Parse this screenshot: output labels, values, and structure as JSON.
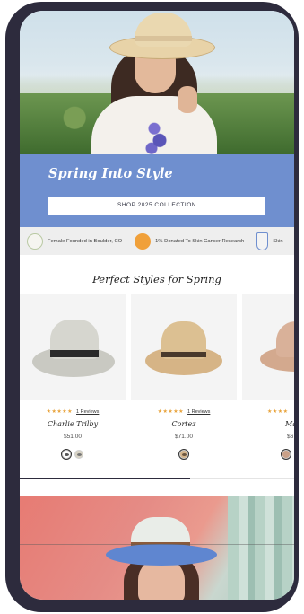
{
  "hero": {
    "title": "Spring Into Style",
    "cta_label": "SHOP 2025 COLLECTION"
  },
  "trust_strip": [
    {
      "icon": "boulder-badge-icon",
      "text": "Female Founded in Boulder, CO"
    },
    {
      "icon": "skin-cancer-badge-icon",
      "text": "1% Donated To Skin Cancer Research"
    },
    {
      "icon": "shield-badge-icon",
      "text": "Skin"
    }
  ],
  "section": {
    "title": "Perfect Styles for Spring"
  },
  "products": [
    {
      "name": "Charlie Trilby",
      "price": "$51.00",
      "stars": "★★★★★",
      "reviews": "1 Reviews",
      "swatches": [
        {
          "color": "#ffffff",
          "selected": true
        },
        {
          "color": "#d8d3c5",
          "selected": false
        }
      ]
    },
    {
      "name": "Cortez",
      "price": "$71.00",
      "stars": "★★★★★",
      "reviews": "1 Reviews",
      "swatches": [
        {
          "color": "#d4b48a",
          "selected": true
        }
      ]
    },
    {
      "name": "Ma",
      "price": "$6",
      "stars": "★★★★",
      "reviews": "",
      "swatches": [
        {
          "color": "#c9a088",
          "selected": true
        }
      ]
    }
  ],
  "carousel": {
    "progress_fraction": 0.62
  },
  "colors": {
    "promo_blue": "#6f8fcf",
    "star_orange": "#e8a33b",
    "frame": "#2d2b3d"
  }
}
